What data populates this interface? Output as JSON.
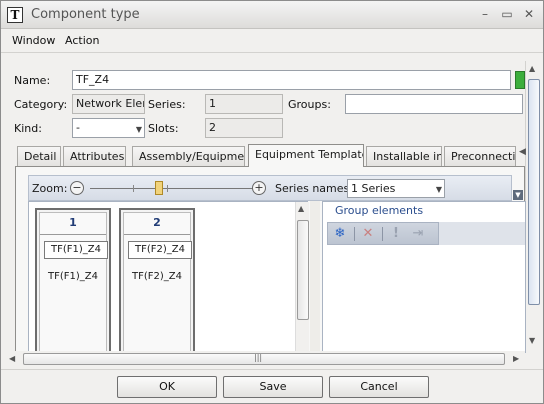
{
  "window": {
    "title": "Component type",
    "icon": "T-icon",
    "controls": [
      "–",
      "▭",
      "✕"
    ]
  },
  "menu": [
    "Window",
    "Action"
  ],
  "form": {
    "name_label": "Name:",
    "name_value": "TF_Z4",
    "category_label": "Category:",
    "category_value": "Network Eleme",
    "series_label": "Series:",
    "series_value": "1",
    "groups_label": "Groups:",
    "groups_value": "",
    "kind_label": "Kind:",
    "kind_value": "-",
    "slots_label": "Slots:",
    "slots_value": "2"
  },
  "tabs": [
    {
      "label": "Detail",
      "active": false
    },
    {
      "label": "Attributes",
      "active": false
    },
    {
      "label": "Assembly/Equipment",
      "active": false
    },
    {
      "label": "Equipment Template",
      "active": true
    },
    {
      "label": "Installable in",
      "active": false
    },
    {
      "label": "Preconnecti",
      "active": false
    }
  ],
  "template": {
    "zoom_label": "Zoom:",
    "zoom_minus": "−",
    "zoom_plus": "+",
    "zoom_level": 0.42,
    "series_names_label": "Series names:",
    "series_names_value": "1 Series",
    "slots": [
      {
        "number": "1",
        "element": "TF(F1)_Z4",
        "label": "TF(F1)_Z4"
      },
      {
        "number": "2",
        "element": "TF(F2)_Z4",
        "label": "TF(F2)_Z4"
      }
    ],
    "group_title": "Group elements",
    "group_tools": [
      "snowflake-icon",
      "delete-icon",
      "exclamation-icon",
      "move-icon"
    ]
  },
  "buttons": {
    "ok": "OK",
    "save": "Save",
    "cancel": "Cancel"
  },
  "colors": {
    "accent": "#2a4d8d",
    "slot_number": "#213c76",
    "panel_toolbar": "#d6dce6"
  }
}
